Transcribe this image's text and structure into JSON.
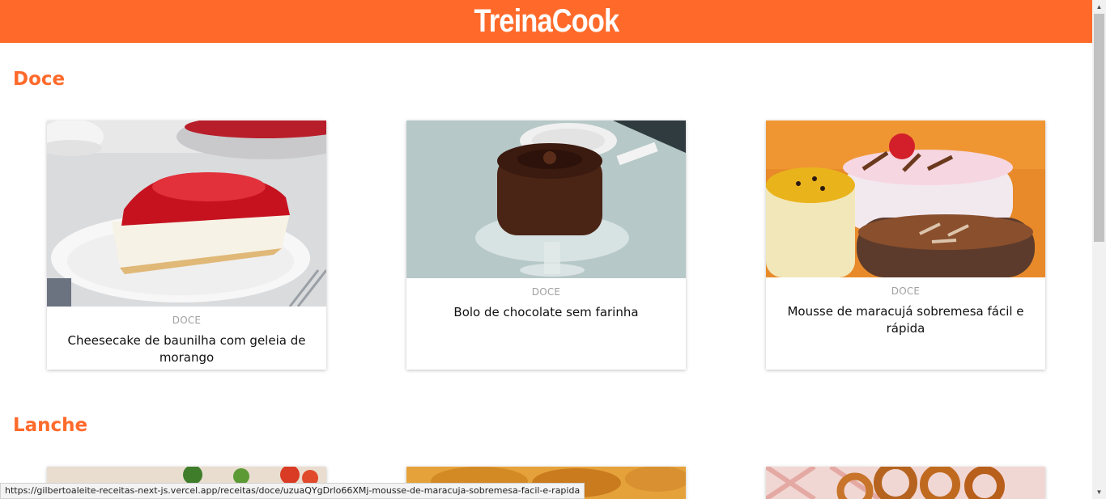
{
  "header": {
    "logo": "TreinaCook"
  },
  "sections": [
    {
      "title": "Doce",
      "cards": [
        {
          "category": "DOCE",
          "title": "Cheesecake de baunilha com geleia de morango",
          "image": "cheesecake-photo"
        },
        {
          "category": "DOCE",
          "title": "Bolo de chocolate sem farinha",
          "image": "chocolate-cake-photo"
        },
        {
          "category": "DOCE",
          "title": "Mousse de maracujá sobremesa fácil e rápida",
          "image": "mousse-photo"
        }
      ]
    },
    {
      "title": "Lanche",
      "cards": [
        {
          "image": "salad-photo"
        },
        {
          "image": "fried-snacks-photo"
        },
        {
          "image": "onion-rings-photo"
        }
      ]
    }
  ],
  "status_bar": {
    "url": "https://gilbertoaleite-receitas-next-js.vercel.app/receitas/doce/uzuaQYgDrlo66XMj-mousse-de-maracuja-sobremesa-facil-e-rapida"
  },
  "colors": {
    "brand": "#ff6a2b",
    "background": "#ffffff"
  }
}
